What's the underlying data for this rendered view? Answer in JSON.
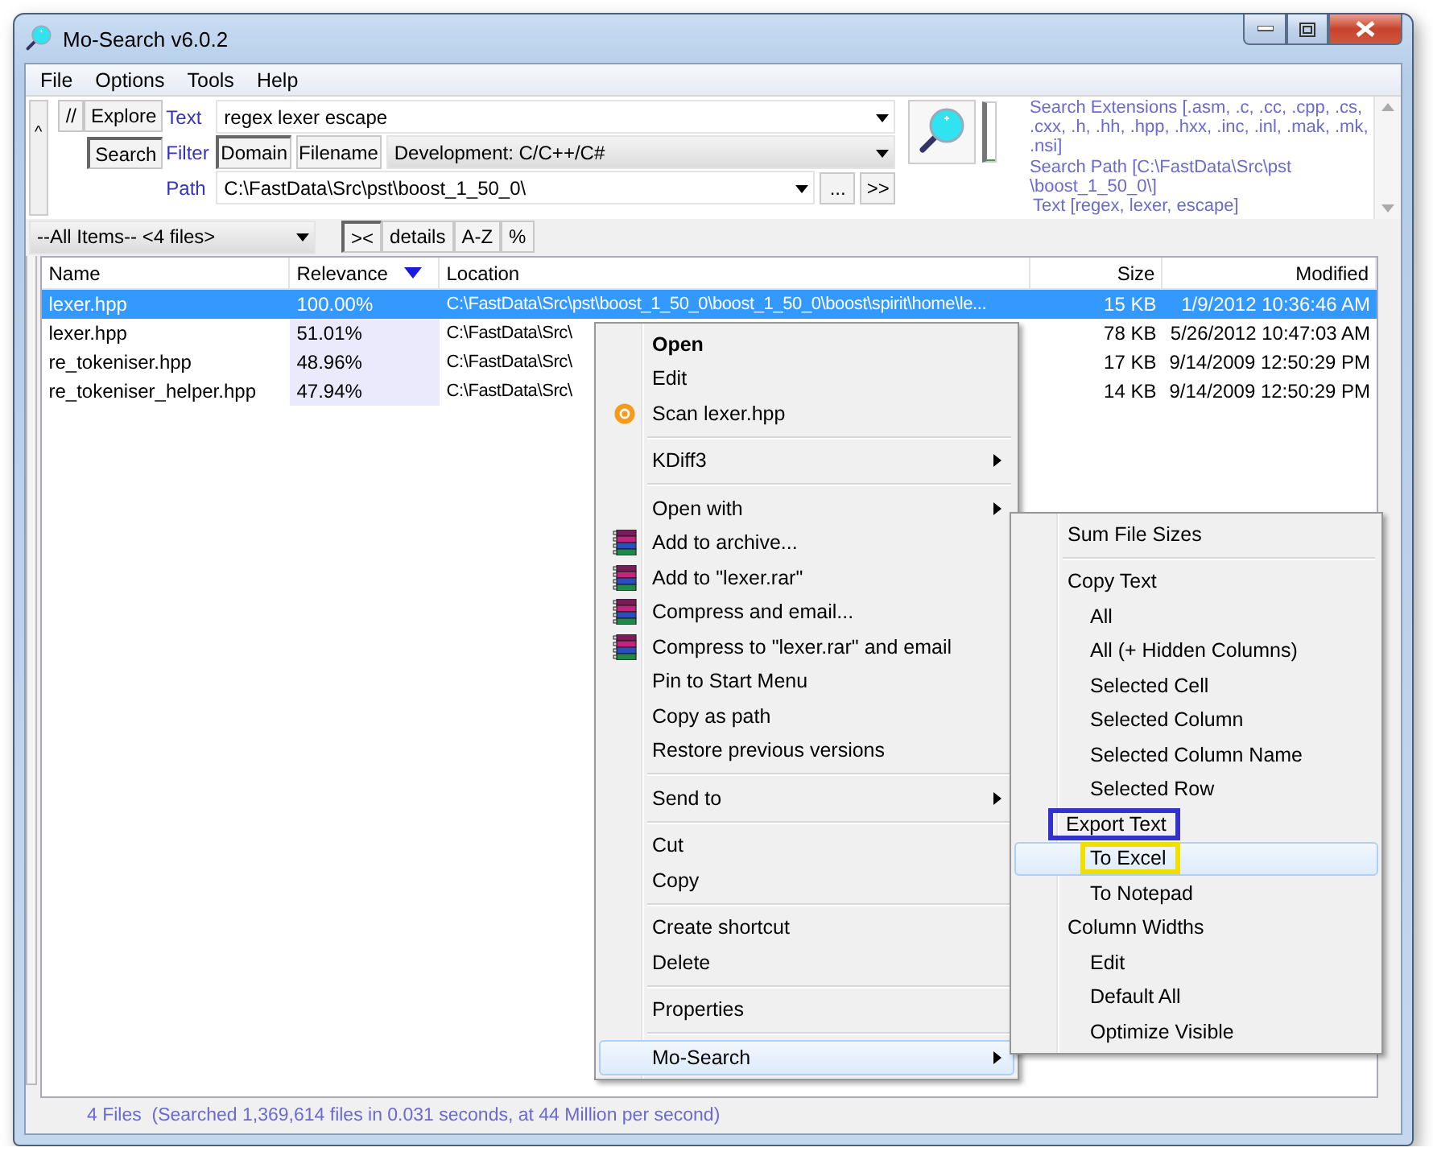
{
  "window": {
    "title": "Mo-Search v6.0.2"
  },
  "menu_bar": [
    "File",
    "Options",
    "Tools",
    "Help"
  ],
  "search_panel": {
    "collapse_button": "^",
    "regex_button": "//",
    "explore_button": "Explore",
    "search_button": "Search",
    "text": {
      "label": "Text",
      "value": "regex lexer escape"
    },
    "filter": {
      "label": "Filter",
      "toggles": [
        {
          "label": "Domain",
          "selected": true
        },
        {
          "label": "Filename",
          "selected": false
        }
      ],
      "value": "Development: C/C++/C#"
    },
    "path": {
      "label": "Path",
      "value": "C:\\FastData\\Src\\pst\\boost_1_50_0\\",
      "browse_button": "...",
      "next_button": ">>"
    },
    "progress": {
      "level": 0
    },
    "summary": [
      "Search Extensions [.asm, .c, .cc, .cpp, .cs, .cxx, .h, .hh, .hpp, .hxx, .inc, .inl, .mak, .mk, .nsi]",
      "Search Path [C:\\FastData\\Src\\pst \\boost_1_50_0\\]",
      "Text [regex, lexer, escape]"
    ]
  },
  "toolbar": {
    "items_select": "--All Items-- <4 files>",
    "view_buttons": [
      {
        "label": "><",
        "selected": true
      },
      {
        "label": "details",
        "selected": false
      },
      {
        "label": "A-Z",
        "selected": false
      },
      {
        "label": "%",
        "selected": false
      }
    ]
  },
  "table": {
    "columns": [
      {
        "label": "Name",
        "sorted": false
      },
      {
        "label": "Relevance",
        "sorted": true
      },
      {
        "label": "Location",
        "sorted": false
      },
      {
        "label": "Size",
        "sorted": false
      },
      {
        "label": "Modified",
        "sorted": false
      }
    ],
    "rows": [
      {
        "name": "lexer.hpp",
        "relevance": "100.00%",
        "location": "C:\\FastData\\Src\\pst\\boost_1_50_0\\boost_1_50_0\\boost\\spirit\\home\\le...",
        "size": "15 KB",
        "modified": "1/9/2012 10:36:46 AM",
        "selected": true
      },
      {
        "name": "lexer.hpp",
        "relevance": "51.01%",
        "location": "C:\\FastData\\Src\\",
        "size": "78 KB",
        "modified": "5/26/2012 10:47:03 AM",
        "selected": false
      },
      {
        "name": "re_tokeniser.hpp",
        "relevance": "48.96%",
        "location": "C:\\FastData\\Src\\",
        "size": "17 KB",
        "modified": "9/14/2009 12:50:29 PM",
        "selected": false
      },
      {
        "name": "re_tokeniser_helper.hpp",
        "relevance": "47.94%",
        "location": "C:\\FastData\\Src\\",
        "size": "14 KB",
        "modified": "9/14/2009 12:50:29 PM",
        "selected": false
      }
    ]
  },
  "status_bar": "4 Files  (Searched 1,369,614 files in 0.031 seconds, at 44 Million per second)",
  "context_menu": {
    "items": [
      {
        "kind": "item",
        "label": "Open",
        "default": true,
        "submenu": false,
        "selected": false
      },
      {
        "kind": "item",
        "label": "Edit",
        "default": false,
        "submenu": false,
        "selected": false
      },
      {
        "kind": "scan",
        "label": "Scan lexer.hpp",
        "default": false,
        "submenu": false,
        "selected": false
      },
      {
        "kind": "separator"
      },
      {
        "kind": "item",
        "label": "KDiff3",
        "default": false,
        "submenu": true,
        "selected": false
      },
      {
        "kind": "separator"
      },
      {
        "kind": "item",
        "label": "Open with",
        "default": false,
        "submenu": true,
        "selected": false
      },
      {
        "kind": "archive",
        "label": "Add to archive...",
        "default": false,
        "submenu": false,
        "selected": false
      },
      {
        "kind": "archive",
        "label": "Add to \"lexer.rar\"",
        "default": false,
        "submenu": false,
        "selected": false
      },
      {
        "kind": "archive",
        "label": "Compress and email...",
        "default": false,
        "submenu": false,
        "selected": false
      },
      {
        "kind": "archive",
        "label": "Compress to \"lexer.rar\" and email",
        "default": false,
        "submenu": false,
        "selected": false
      },
      {
        "kind": "item",
        "label": "Pin to Start Menu",
        "default": false,
        "submenu": false,
        "selected": false
      },
      {
        "kind": "item",
        "label": "Copy as path",
        "default": false,
        "submenu": false,
        "selected": false
      },
      {
        "kind": "item",
        "label": "Restore previous versions",
        "default": false,
        "submenu": false,
        "selected": false
      },
      {
        "kind": "separator"
      },
      {
        "kind": "item",
        "label": "Send to",
        "default": false,
        "submenu": true,
        "selected": false
      },
      {
        "kind": "separator"
      },
      {
        "kind": "item",
        "label": "Cut",
        "default": false,
        "submenu": false,
        "selected": false
      },
      {
        "kind": "item",
        "label": "Copy",
        "default": false,
        "submenu": false,
        "selected": false
      },
      {
        "kind": "separator"
      },
      {
        "kind": "item",
        "label": "Create shortcut",
        "default": false,
        "submenu": false,
        "selected": false
      },
      {
        "kind": "item",
        "label": "Delete",
        "default": false,
        "submenu": false,
        "selected": false
      },
      {
        "kind": "separator"
      },
      {
        "kind": "item",
        "label": "Properties",
        "default": false,
        "submenu": false,
        "selected": false
      },
      {
        "kind": "separator"
      },
      {
        "kind": "item",
        "label": "Mo-Search",
        "default": false,
        "submenu": true,
        "selected": true
      }
    ]
  },
  "submenu": {
    "items": [
      {
        "kind": "item",
        "label": "Sum File Sizes",
        "selected": false
      },
      {
        "kind": "separator"
      },
      {
        "kind": "item",
        "label": "Copy Text",
        "selected": false,
        "children": [
          {
            "label": "All",
            "selected": false
          },
          {
            "label": "All (+ Hidden Columns)",
            "selected": false
          },
          {
            "label": "Selected Cell",
            "selected": false
          },
          {
            "label": "Selected Column",
            "selected": false
          },
          {
            "label": "Selected Column Name",
            "selected": false
          },
          {
            "label": "Selected Row",
            "selected": false
          }
        ]
      },
      {
        "kind": "item",
        "label": "Export Text",
        "selected": false,
        "color": "#3333cc",
        "children": [
          {
            "label": "To Excel",
            "selected": true,
            "color": "#f0e000"
          },
          {
            "label": "To Notepad",
            "selected": false
          }
        ]
      },
      {
        "kind": "item",
        "label": "Column Widths",
        "selected": false,
        "children": [
          {
            "label": "Edit",
            "selected": false
          },
          {
            "label": "Default All",
            "selected": false
          },
          {
            "label": "Optimize Visible",
            "selected": false
          }
        ]
      }
    ]
  }
}
